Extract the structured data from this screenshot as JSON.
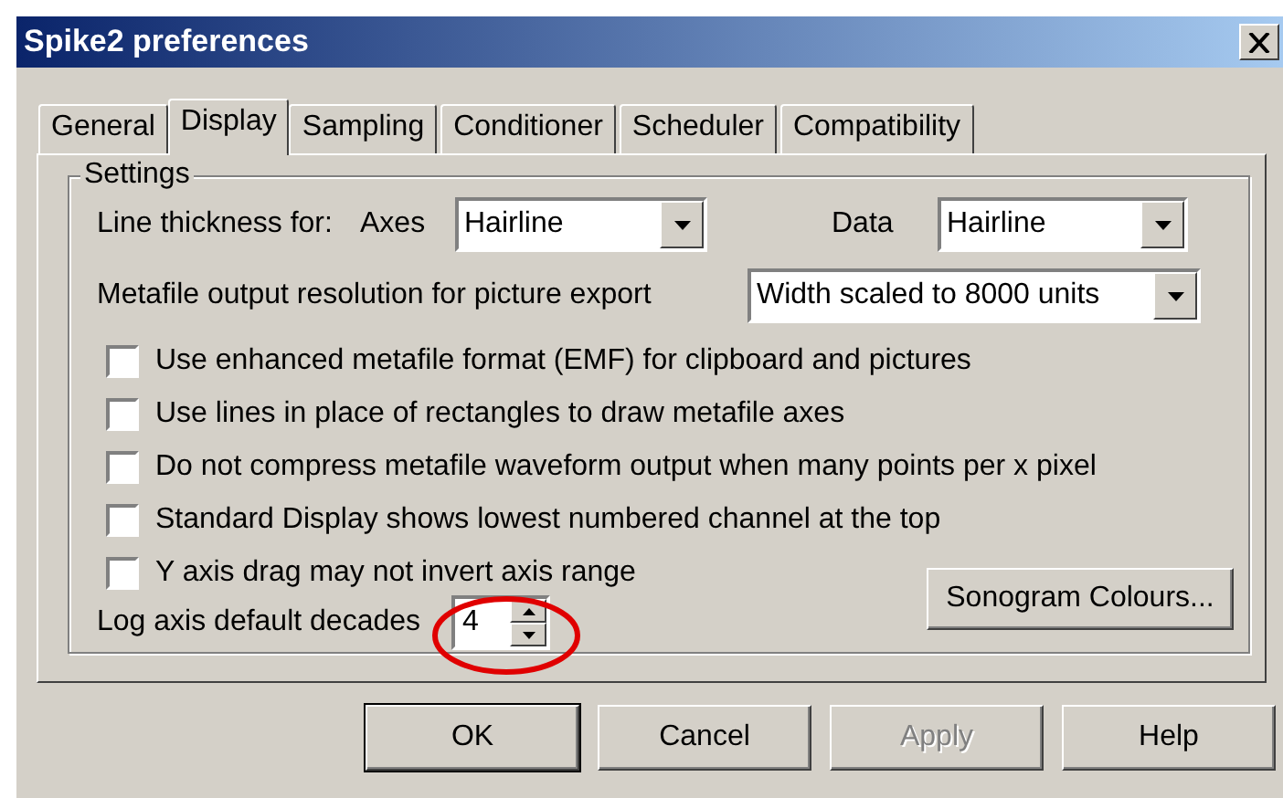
{
  "window": {
    "title": "Spike2 preferences"
  },
  "tabs": [
    {
      "label": "General",
      "selected": false
    },
    {
      "label": "Display",
      "selected": true
    },
    {
      "label": "Sampling",
      "selected": false
    },
    {
      "label": "Conditioner",
      "selected": false
    },
    {
      "label": "Scheduler",
      "selected": false
    },
    {
      "label": "Compatibility",
      "selected": false
    }
  ],
  "settings": {
    "title": "Settings",
    "line_thickness": {
      "label": "Line thickness for:",
      "axes": {
        "label": "Axes",
        "value": "Hairline"
      },
      "data": {
        "label": "Data",
        "value": "Hairline"
      }
    },
    "metafile_resolution": {
      "label": "Metafile output resolution for picture export",
      "value": "Width scaled to 8000 units"
    },
    "checkboxes": [
      {
        "label": "Use enhanced metafile format (EMF) for clipboard and pictures",
        "checked": false
      },
      {
        "label": "Use lines in place of rectangles to draw metafile axes",
        "checked": false
      },
      {
        "label": "Do not compress metafile waveform output when many points per x pixel",
        "checked": false
      },
      {
        "label": "Standard Display shows lowest numbered channel at the top",
        "checked": false
      },
      {
        "label": "Y axis drag may not invert axis range",
        "checked": false
      }
    ],
    "log_decades": {
      "label": "Log axis default decades",
      "value": "4"
    },
    "sonogram_button": "Sonogram Colours..."
  },
  "buttons": [
    {
      "label": "OK",
      "disabled": false,
      "default": true
    },
    {
      "label": "Cancel",
      "disabled": false,
      "default": false
    },
    {
      "label": "Apply",
      "disabled": true,
      "default": false
    },
    {
      "label": "Help",
      "disabled": false,
      "default": false
    }
  ]
}
